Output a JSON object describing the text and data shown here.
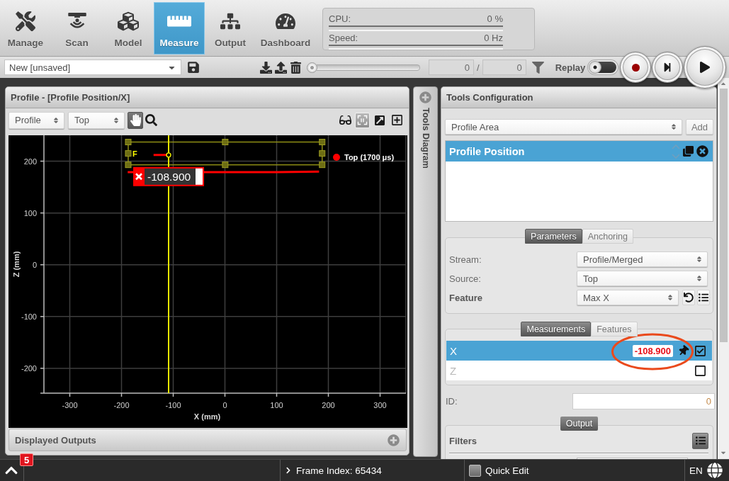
{
  "nav_tabs": [
    {
      "label": "Manage",
      "selected": false
    },
    {
      "label": "Scan",
      "selected": false
    },
    {
      "label": "Model",
      "selected": false
    },
    {
      "label": "Measure",
      "selected": true
    },
    {
      "label": "Output",
      "selected": false
    },
    {
      "label": "Dashboard",
      "selected": false
    }
  ],
  "system_stats": [
    {
      "label": "CPU:",
      "value": "0 %"
    },
    {
      "label": "Speed:",
      "value": "0 Hz"
    }
  ],
  "toolbar": {
    "job": {
      "value": "New [unsaved]"
    },
    "frame_slider": {
      "level": 0
    },
    "frame_current": "0",
    "frame_separator": "/",
    "frame_total": "0",
    "replay": {
      "label": "Replay",
      "on": false
    }
  },
  "profile_panel": {
    "title": "Profile - [Profile Position/X]",
    "view_select": "Profile",
    "source_select": "Top",
    "view_tools": [
      {
        "selected": true
      },
      {
        "selected": false
      }
    ],
    "display_tools": [
      {
        "selected": false
      },
      {
        "selected": true
      },
      {
        "selected": false
      },
      {
        "selected": false
      }
    ],
    "chart_data": {
      "type": "line",
      "xlabel": "X (mm)",
      "ylabel": "Z (mm)",
      "x": [
        -188,
        -138,
        -109,
        -30,
        0,
        100,
        182
      ],
      "series": [
        {
          "name": "Top (1700 μs)",
          "color": "#ff0000",
          "values": [
            179,
            null,
            null,
            179,
            179,
            179,
            180
          ]
        },
        {
          "color": "#ff0000",
          "values": [
            null,
            212,
            212,
            null,
            null,
            null,
            null
          ]
        }
      ],
      "xlim": [
        -350,
        350
      ],
      "ylim": [
        -248,
        250
      ],
      "xticks": [
        -300,
        -200,
        -100,
        0,
        100,
        200,
        300
      ],
      "yticks": [
        -200,
        -100,
        0,
        100,
        200
      ],
      "grid": true,
      "ref_lines": [
        {
          "axis": "x",
          "value": -108.9,
          "color": "#e6e600"
        }
      ],
      "annotations": [
        "F",
        "-108.900"
      ]
    },
    "displayed_outputs": "Displayed Outputs"
  },
  "tools_diagram": {
    "label": "Tools Diagram"
  },
  "tools_config": {
    "title": "Tools Configuration",
    "tool_type": "Profile Area",
    "add_button": "Add",
    "tools": [
      {
        "name": "Profile Position",
        "selected": true
      }
    ],
    "parameter_tabs": [
      {
        "label": "Parameters",
        "selected": true
      },
      {
        "label": "Anchoring",
        "selected": false
      }
    ],
    "parameters": [
      {
        "kind": "select",
        "label": "Stream:",
        "value": "Profile/Merged"
      },
      {
        "kind": "select",
        "label": "Source:",
        "value": "Top"
      },
      {
        "kind": "feature",
        "label": "Feature",
        "value": "Max X"
      }
    ],
    "measurement_tabs": [
      {
        "label": "Measurements",
        "selected": true
      },
      {
        "label": "Features",
        "selected": false
      }
    ],
    "measurements": [
      {
        "name": "X",
        "selected": true,
        "checked": true,
        "value": "-108.900"
      },
      {
        "name": "Z",
        "selected": false,
        "checked": false
      }
    ],
    "id_field": {
      "label": "ID:",
      "value": "0"
    },
    "output_section": "Output",
    "filters_label": "Filters"
  },
  "status_bar": {
    "notification_count": "5",
    "frame_index": "Frame Index: 65434",
    "quick_edit": {
      "label": "Quick Edit",
      "checked": false
    },
    "language": "EN"
  }
}
